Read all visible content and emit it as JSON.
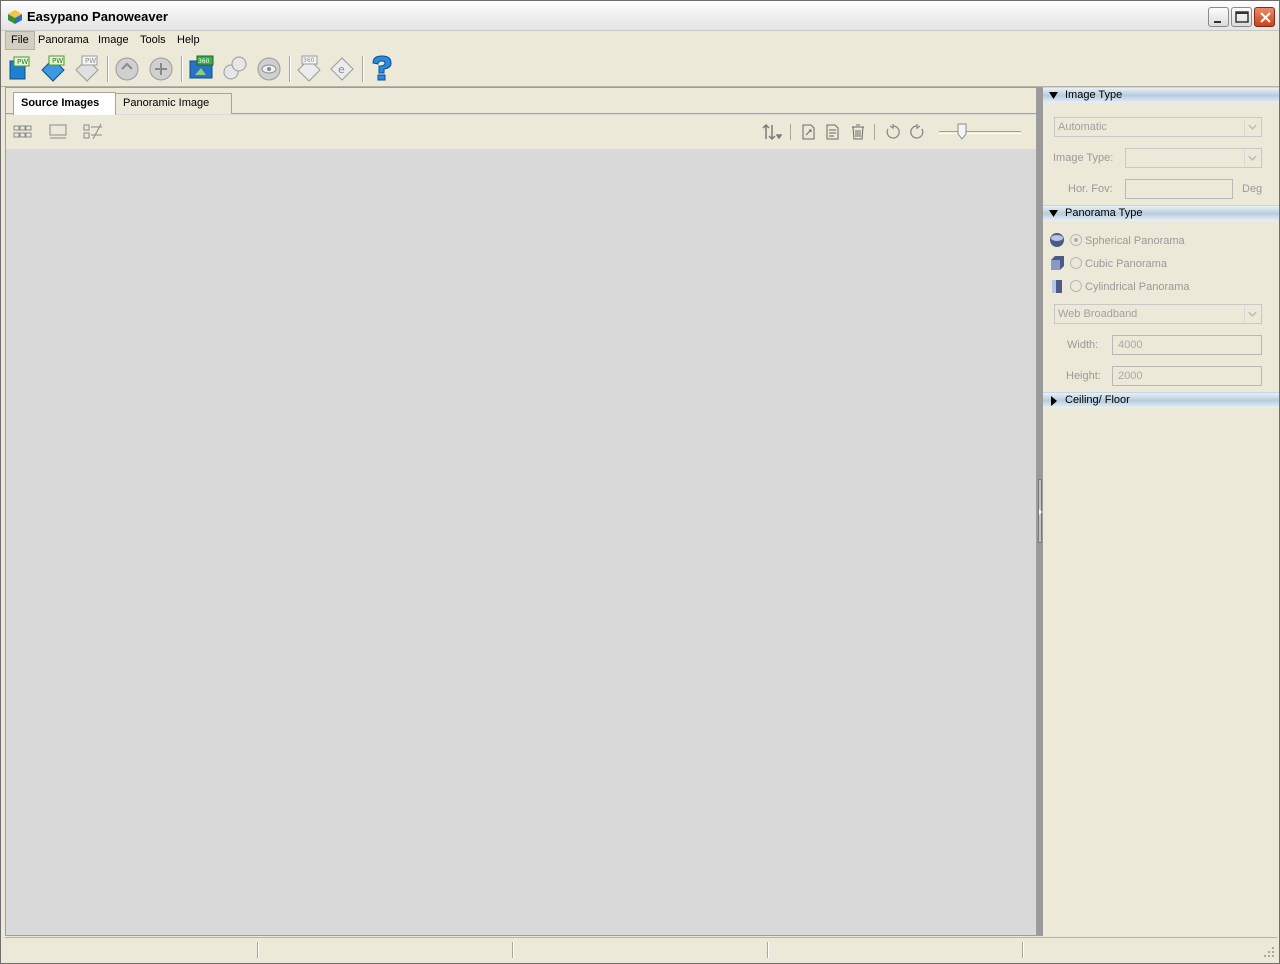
{
  "window": {
    "title": "Easypano Panoweaver"
  },
  "menu": {
    "items": [
      "File",
      "Panorama",
      "Image",
      "Tools",
      "Help"
    ]
  },
  "toolbar": {
    "buttons": [
      {
        "name": "new-project-icon"
      },
      {
        "name": "open-project-icon"
      },
      {
        "name": "save-project-icon"
      },
      {
        "name": "stitch-icon"
      },
      {
        "name": "stitch-all-icon"
      },
      {
        "name": "publish-360-icon"
      },
      {
        "name": "batch-stitch-icon"
      },
      {
        "name": "preview-icon"
      },
      {
        "name": "export-360-icon"
      },
      {
        "name": "export-e-icon"
      },
      {
        "name": "help-icon"
      }
    ]
  },
  "tabs": {
    "source_images": "Source Images",
    "panoramic_image": "Panoramic Image"
  },
  "image_type": {
    "header": "Image Type",
    "combo_value": "Automatic",
    "image_type_label": "Image Type:",
    "image_type_value": "",
    "hor_fov_label": "Hor. Fov:",
    "hor_fov_value": "",
    "deg_label": "Deg"
  },
  "panorama_type": {
    "header": "Panorama Type",
    "options": [
      "Spherical Panorama",
      "Cubic Panorama",
      "Cylindrical Panorama"
    ],
    "selected": "Spherical Panorama",
    "preset": "Web Broadband",
    "width_label": "Width:",
    "width_value": "4000",
    "height_label": "Height:",
    "height_value": "2000"
  },
  "ceiling_floor": {
    "header": "Ceiling/ Floor"
  },
  "colors": {
    "section_header": "#b6cdde",
    "workspace": "#d9d9d9",
    "close_button": "#c8421c"
  }
}
